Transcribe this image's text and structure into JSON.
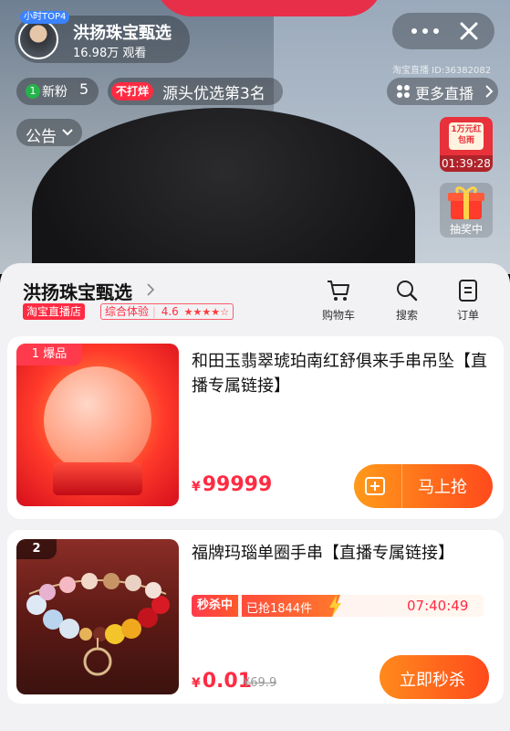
{
  "stream": {
    "anchor_badge": "小时TOP4",
    "anchor_name": "洪扬珠宝甄选",
    "viewers": "16.98万 观看",
    "room_id": "淘宝直播 ID:36382082",
    "fans_label": "新粉",
    "fans_count": "5",
    "rank_badge": "不打烊",
    "rank_text": "源头优选第3名",
    "more_live": "更多直播",
    "notice": "公告",
    "redpack_text": "1万元红包雨",
    "redpack_timer": "01:39:28",
    "lottery_label": "抽奖中"
  },
  "shop": {
    "name": "洪扬珠宝甄选",
    "platform_badge": "淘宝直播店",
    "rating_label": "综合体验",
    "rating_score": "4.6",
    "rating_stars": 4.5,
    "nav": [
      {
        "label": "购物车",
        "icon": "cart-icon"
      },
      {
        "label": "搜索",
        "icon": "search-icon"
      },
      {
        "label": "订单",
        "icon": "order-icon"
      }
    ]
  },
  "products": [
    {
      "tag": "1 爆品",
      "title": "和田玉翡翠琥珀南红舒俱来手串吊坠【直播专属链接】",
      "price_symbol": "¥",
      "price": "99999",
      "button": "马上抢"
    },
    {
      "tag": "2",
      "title": "福牌玛瑙单圈手串【直播专属链接】",
      "flash_label": "秒杀中",
      "sold_label": "已抢1844件",
      "countdown": "07:40:49",
      "price_symbol": "¥",
      "price": "0.01",
      "original_price": "¥69.9",
      "button": "立即秒杀"
    }
  ],
  "colors": {
    "accent": "#ff2b42",
    "button_orange": "#ff6a1c"
  }
}
